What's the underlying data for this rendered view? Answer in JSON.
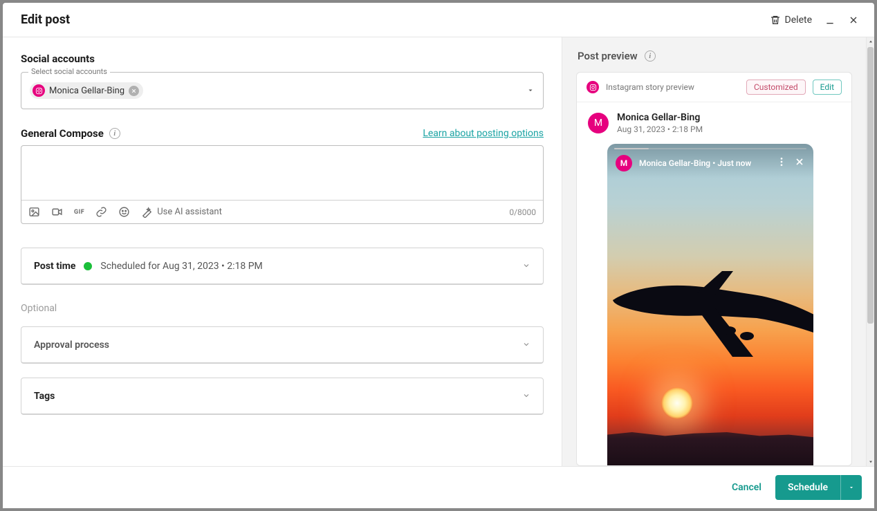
{
  "header": {
    "title": "Edit post",
    "delete_label": "Delete"
  },
  "social": {
    "section_title": "Social accounts",
    "field_legend": "Select social accounts",
    "selected_account": "Monica Gellar-Bing"
  },
  "compose": {
    "section_title": "General Compose",
    "learn_link": "Learn about posting options",
    "ai_label": "Use AI assistant",
    "char_count": "0/8000",
    "gif_label": "GIF"
  },
  "post_time": {
    "title": "Post time",
    "scheduled_text": "Scheduled for Aug 31, 2023 • 2:18 PM"
  },
  "optional_label": "Optional",
  "approval": {
    "title": "Approval process"
  },
  "tags": {
    "title": "Tags"
  },
  "preview": {
    "header": "Post preview",
    "subtype": "Instagram story preview",
    "customized_label": "Customized",
    "edit_label": "Edit",
    "user_name": "Monica Gellar-Bing",
    "user_time": "Aug 31, 2023 • 2:18 PM",
    "avatar_initial": "M",
    "story_name": "Monica Gellar-Bing • Just now"
  },
  "footer": {
    "cancel": "Cancel",
    "schedule": "Schedule"
  }
}
